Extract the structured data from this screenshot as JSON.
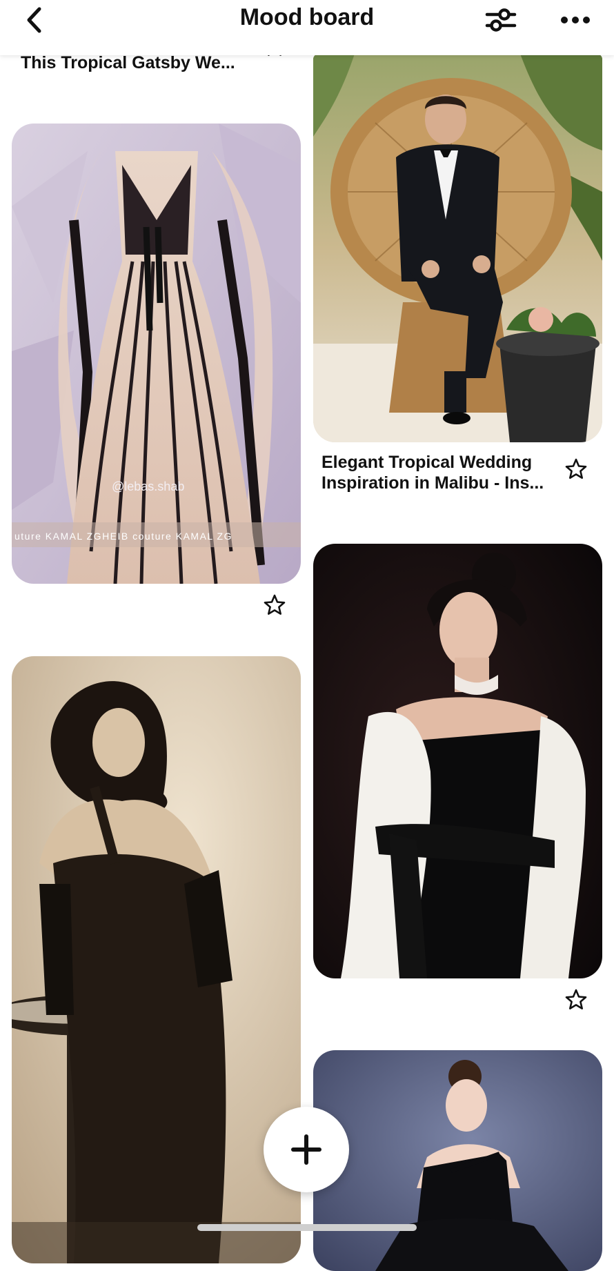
{
  "header": {
    "title": "Mood board"
  },
  "icons": {
    "back": "chevron-left-icon",
    "filter": "sliders-icon",
    "more": "ellipsis-icon",
    "star": "star-outline-icon",
    "add": "plus-icon"
  },
  "pins": [
    {
      "title": "This Tropical Gatsby We...",
      "image": "tropical-gatsby-wedding"
    },
    {
      "title": "",
      "image": "beaded-black-and-blush-gown",
      "watermark": "@lebas.shab",
      "caption_strip": "uture  KAMAL ZGHEIB couture  KAMAL ZG"
    },
    {
      "title": "Elegant Tropical Wedding Inspiration in Malibu - Ins...",
      "image": "groom-in-peacock-chair"
    },
    {
      "title": "",
      "image": "sepia-vintage-glamour-portrait"
    },
    {
      "title": "",
      "image": "black-dress-with-white-fur-stole"
    },
    {
      "title": "",
      "image": "one-shoulder-black-gown"
    }
  ],
  "colors": {
    "background": "#ffffff",
    "text": "#111111",
    "fab_background": "#ffffff"
  }
}
